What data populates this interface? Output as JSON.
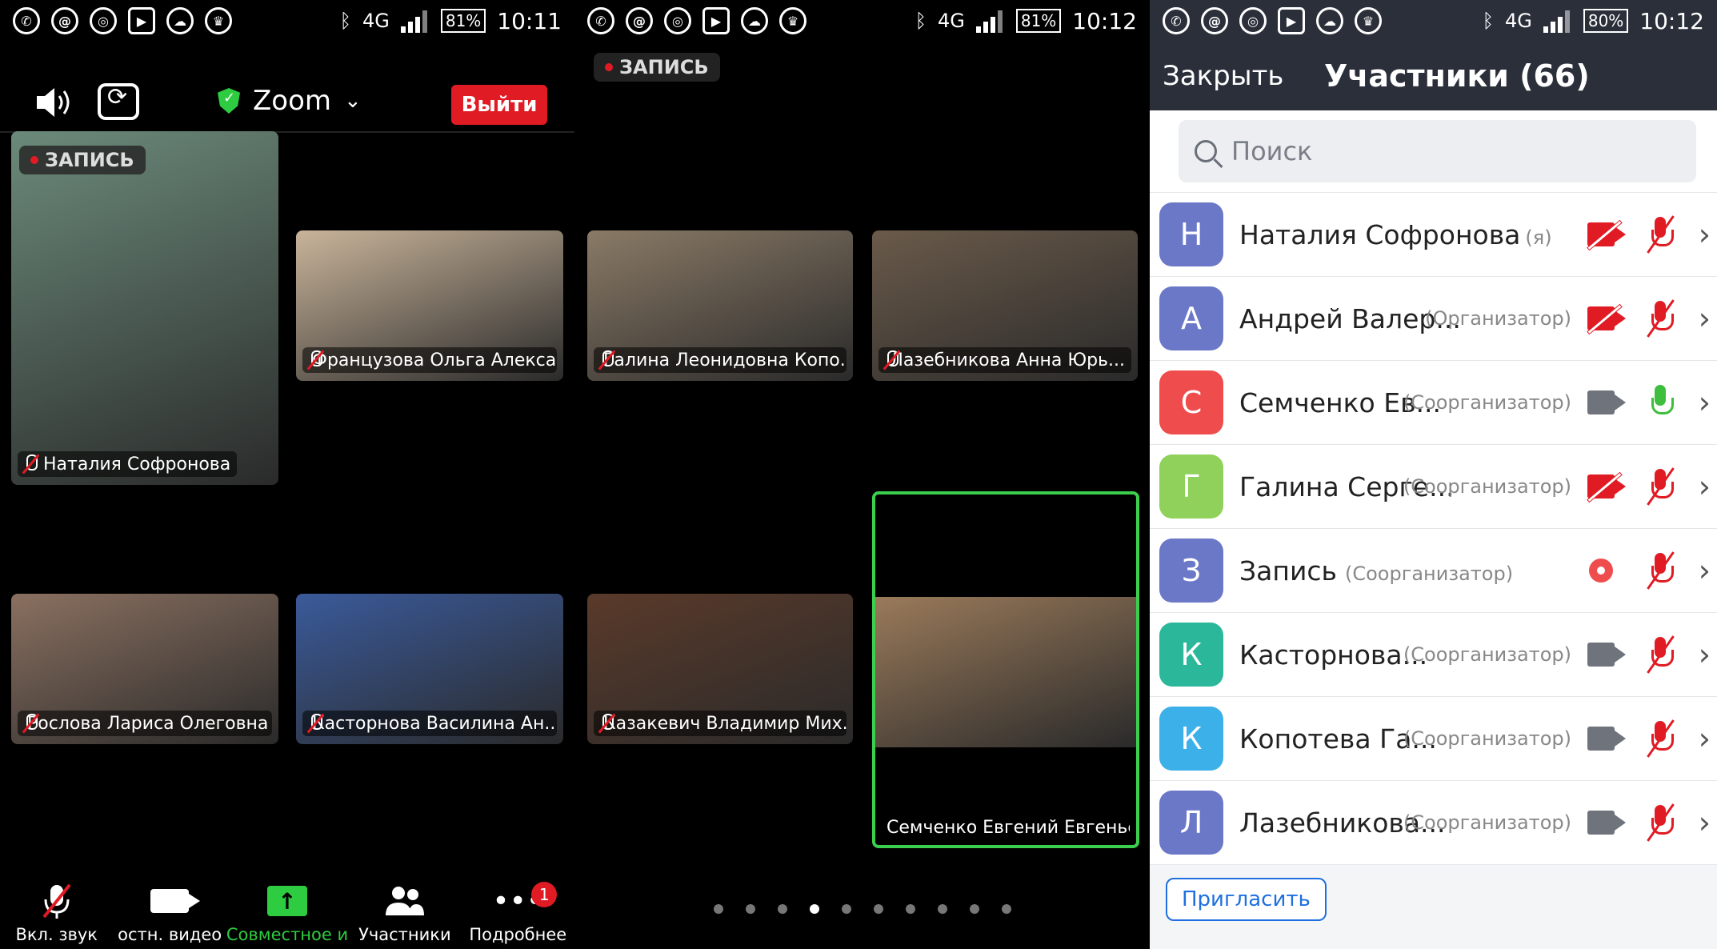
{
  "screens": [
    {
      "time": "10:11",
      "battery": "81%",
      "network": "4G"
    },
    {
      "time": "10:12",
      "battery": "81%",
      "network": "4G"
    },
    {
      "time": "10:12",
      "battery": "80%",
      "network": "4G"
    }
  ],
  "meeting": {
    "brand": "Zoom",
    "leave_label": "Выйти",
    "recording_label": "ЗАПИСЬ"
  },
  "page1_tiles": [
    {
      "name": "Наталия Софронова",
      "muted": true,
      "bg": "#6b8a7a"
    },
    {
      "name": "Французова Ольга Алекса...",
      "muted": true,
      "bg": "#c9b49a"
    },
    {
      "name": "Рослова Лариса Олеговна",
      "muted": true,
      "bg": "#8a7060"
    },
    {
      "name": "Касторнова Василина Ан...",
      "muted": true,
      "bg": "#3a5a9a"
    }
  ],
  "page2_tiles": [
    {
      "name": "Галина Леонидовна Копо...",
      "muted": true,
      "bg": "#8a7a66"
    },
    {
      "name": "Лазебникова Анна Юрь...",
      "muted": true,
      "bg": "#6a5a4a"
    },
    {
      "name": "Казакевич Владимир Мих...",
      "muted": true,
      "bg": "#5a3a2a"
    },
    {
      "name": "Семченко Евгений Евгеньев...",
      "muted": false,
      "bg": "#9a7a5a",
      "active_speaker": true
    }
  ],
  "toolbar": {
    "mute_label": "Вкл. звук",
    "video_label": "остн. видео",
    "share_label": "Совместное и",
    "participants_label": "Участники",
    "more_label": "Подробнее",
    "more_badge": "1"
  },
  "pager": {
    "count": 10,
    "active_index": 3
  },
  "participants_panel": {
    "close_label": "Закрыть",
    "title": "Участники (66)",
    "search_placeholder": "Поиск",
    "invite_label": "Пригласить",
    "rows": [
      {
        "initial": "Н",
        "name": "Наталия Софронова",
        "me_tag": "(я)",
        "role": "",
        "color": "#6b78c8",
        "video": "off",
        "mic": "off"
      },
      {
        "initial": "А",
        "name": "Андрей Валер...",
        "me_tag": "",
        "role": "(Организатор)",
        "color": "#6b78c8",
        "video": "off",
        "mic": "off"
      },
      {
        "initial": "С",
        "name": "Семченко Ев...",
        "me_tag": "",
        "role": "(Соорганизатор)",
        "color": "#ef4d4d",
        "video": "on",
        "mic": "on"
      },
      {
        "initial": "Г",
        "name": "Галина Серге...",
        "me_tag": "",
        "role": "(Соорганизатор)",
        "color": "#8fd15a",
        "video": "off",
        "mic": "off"
      },
      {
        "initial": "З",
        "name": "Запись",
        "me_tag": "",
        "role": "(Соорганизатор)",
        "color": "#6b78c8",
        "video": "rec",
        "mic": "off"
      },
      {
        "initial": "К",
        "name": "Касторнова...",
        "me_tag": "",
        "role": "(Соорганизатор)",
        "color": "#2bb89a",
        "video": "on",
        "mic": "off"
      },
      {
        "initial": "К",
        "name": "Копотева Га...",
        "me_tag": "",
        "role": "(Соорганизатор)",
        "color": "#3cb0e8",
        "video": "on",
        "mic": "off"
      },
      {
        "initial": "Л",
        "name": "Лазебникова...",
        "me_tag": "",
        "role": "(Соорганизатор)",
        "color": "#6b78c8",
        "video": "on",
        "mic": "off"
      }
    ]
  }
}
